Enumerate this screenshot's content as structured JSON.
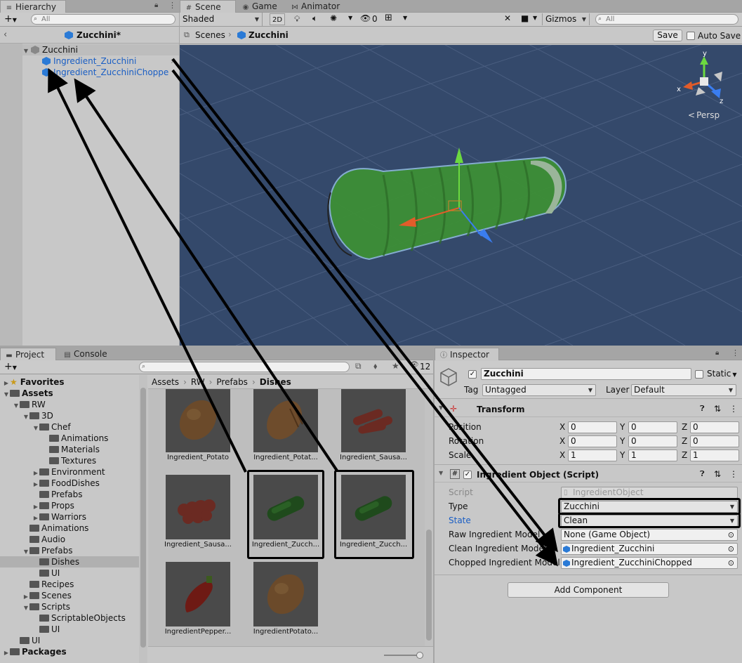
{
  "hierarchy": {
    "tab": "Hierarchy",
    "search_placeholder": "All",
    "prefab_title": "Zucchini*",
    "root": "Zucchini",
    "children": [
      "Ingredient_Zucchini",
      "Ingredient_ZucchiniChoppe"
    ]
  },
  "scene": {
    "tabs": [
      "Scene",
      "Game",
      "Animator"
    ],
    "shading": "Shaded",
    "mode_2d": "2D",
    "hidden_count": "0",
    "gizmos": "Gizmos",
    "search_placeholder": "All",
    "breadcrumb": [
      "Scenes",
      "Zucchini"
    ],
    "save": "Save",
    "auto_save": "Auto Save",
    "persp": "Persp",
    "axes": {
      "x": "x",
      "y": "y",
      "z": "z"
    }
  },
  "project": {
    "tabs": [
      "Project",
      "Console"
    ],
    "count": "12",
    "tree": [
      {
        "label": "Favorites",
        "indent": 0,
        "type": "fav",
        "fold": "▶"
      },
      {
        "label": "Assets",
        "indent": 0,
        "type": "folder",
        "fold": "▼"
      },
      {
        "label": "RW",
        "indent": 1,
        "type": "folder",
        "fold": "▼"
      },
      {
        "label": "3D",
        "indent": 2,
        "type": "folder",
        "fold": "▼"
      },
      {
        "label": "Chef",
        "indent": 3,
        "type": "folder",
        "fold": "▼"
      },
      {
        "label": "Animations",
        "indent": 4,
        "type": "folder",
        "fold": ""
      },
      {
        "label": "Materials",
        "indent": 4,
        "type": "folder",
        "fold": ""
      },
      {
        "label": "Textures",
        "indent": 4,
        "type": "folder",
        "fold": ""
      },
      {
        "label": "Environment",
        "indent": 3,
        "type": "folder",
        "fold": "▶"
      },
      {
        "label": "FoodDishes",
        "indent": 3,
        "type": "folder",
        "fold": "▶"
      },
      {
        "label": "Prefabs",
        "indent": 3,
        "type": "folder",
        "fold": ""
      },
      {
        "label": "Props",
        "indent": 3,
        "type": "folder",
        "fold": "▶"
      },
      {
        "label": "Warriors",
        "indent": 3,
        "type": "folder",
        "fold": "▶"
      },
      {
        "label": "Animations",
        "indent": 2,
        "type": "folder",
        "fold": ""
      },
      {
        "label": "Audio",
        "indent": 2,
        "type": "folder",
        "fold": ""
      },
      {
        "label": "Prefabs",
        "indent": 2,
        "type": "folder",
        "fold": "▼"
      },
      {
        "label": "Dishes",
        "indent": 3,
        "type": "folder",
        "fold": "",
        "selected": true
      },
      {
        "label": "UI",
        "indent": 3,
        "type": "folder",
        "fold": ""
      },
      {
        "label": "Recipes",
        "indent": 2,
        "type": "folder",
        "fold": ""
      },
      {
        "label": "Scenes",
        "indent": 2,
        "type": "folder",
        "fold": "▶"
      },
      {
        "label": "Scripts",
        "indent": 2,
        "type": "folder",
        "fold": "▼"
      },
      {
        "label": "ScriptableObjects",
        "indent": 3,
        "type": "folder",
        "fold": ""
      },
      {
        "label": "UI",
        "indent": 3,
        "type": "folder",
        "fold": ""
      },
      {
        "label": "UI",
        "indent": 1,
        "type": "folder",
        "fold": ""
      },
      {
        "label": "Packages",
        "indent": 0,
        "type": "folder",
        "fold": "▶"
      }
    ],
    "breadcrumb": [
      "Assets",
      "RW",
      "Prefabs",
      "Dishes"
    ],
    "assets": [
      {
        "label": "Ingredient_Potato",
        "food": "potato"
      },
      {
        "label": "Ingredient_Potat...",
        "food": "potato-sliced"
      },
      {
        "label": "Ingredient_Sausa...",
        "food": "sausage"
      },
      {
        "label": "Ingredient_Sausa...",
        "food": "sausage-sliced"
      },
      {
        "label": "Ingredient_Zucch...",
        "food": "zucchini"
      },
      {
        "label": "Ingredient_Zucch...",
        "food": "zucchini"
      },
      {
        "label": "IngredientPepper...",
        "food": "pepper"
      },
      {
        "label": "IngredientPotato...",
        "food": "potato"
      }
    ]
  },
  "inspector": {
    "tab": "Inspector",
    "object_name": "Zucchini",
    "static": "Static",
    "tag_label": "Tag",
    "tag": "Untagged",
    "layer_label": "Layer",
    "layer": "Default",
    "transform": {
      "title": "Transform",
      "rows": [
        {
          "label": "Position",
          "x": "0",
          "y": "0",
          "z": "0"
        },
        {
          "label": "Rotation",
          "x": "0",
          "y": "0",
          "z": "0"
        },
        {
          "label": "Scale",
          "x": "1",
          "y": "1",
          "z": "1"
        }
      ],
      "axis_x": "X",
      "axis_y": "Y",
      "axis_z": "Z"
    },
    "script_component": {
      "title": "Ingredient Object (Script)",
      "script_label": "Script",
      "script_value": "IngredientObject",
      "type_label": "Type",
      "type_value": "Zucchini",
      "state_label": "State",
      "state_value": "Clean",
      "raw_label": "Raw Ingredient Model",
      "raw_value": "None (Game Object)",
      "clean_label": "Clean Ingredient Model",
      "clean_value": "Ingredient_Zucchini",
      "chopped_label": "Chopped Ingredient Model",
      "chopped_value": "Ingredient_ZucchiniChopped"
    },
    "add_component": "Add Component"
  },
  "colors": {
    "scene_bg": "#34496b",
    "accent_blue": "#2a7ad6",
    "state_blue": "#1a5ec4"
  }
}
